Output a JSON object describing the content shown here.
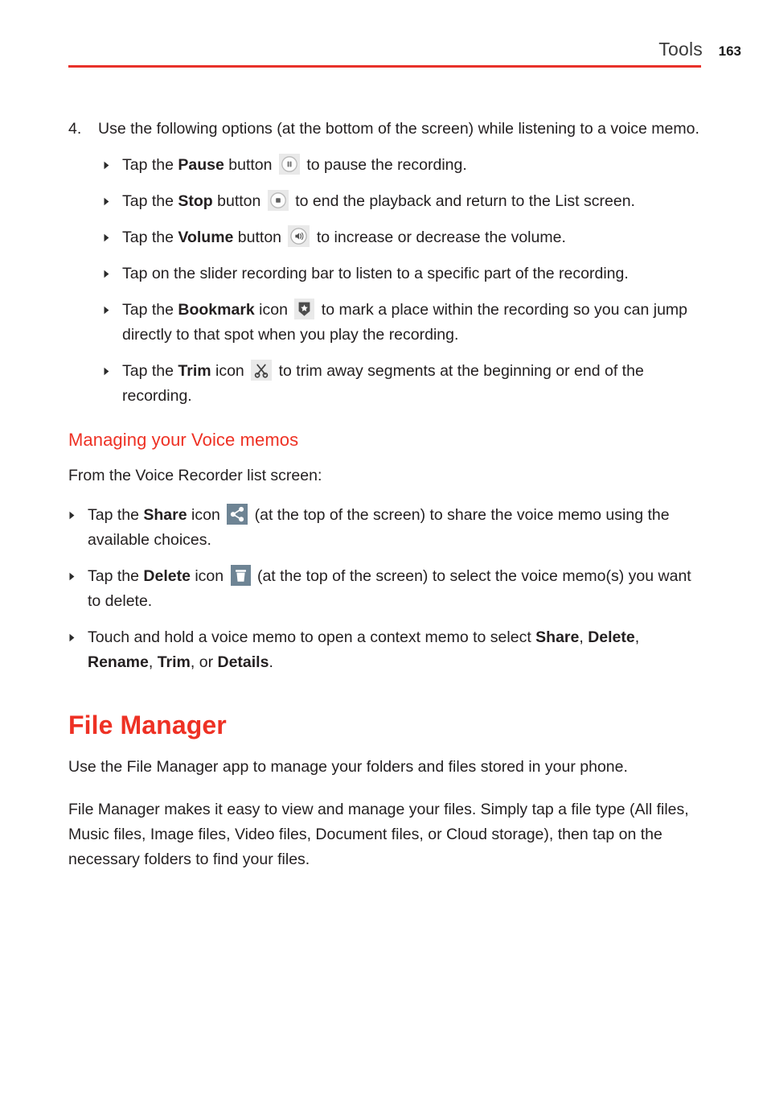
{
  "header": {
    "title": "Tools",
    "page_number": "163",
    "rule_color": "#e8312a"
  },
  "colors": {
    "accent_red": "#ee3124",
    "body_text": "#231f20",
    "icon_chip_gray": "#e9e9e9",
    "icon_chip_blue": "#6e8494",
    "icon_dark": "#4a4a4a"
  },
  "step": {
    "number": "4.",
    "text": "Use the following options (at the bottom of the screen) while listening to a voice memo."
  },
  "step_bullets": [
    {
      "id": "pause",
      "icon": "pause-button-icon",
      "parts": [
        {
          "t": "Tap the ",
          "b": false
        },
        {
          "t": "Pause",
          "b": true
        },
        {
          "t": " button ",
          "b": false
        }
      ],
      "after": " to pause the recording."
    },
    {
      "id": "stop",
      "icon": "stop-button-icon",
      "parts": [
        {
          "t": "Tap the ",
          "b": false
        },
        {
          "t": "Stop",
          "b": true
        },
        {
          "t": " button ",
          "b": false
        }
      ],
      "after": " to end the playback and return to the List screen."
    },
    {
      "id": "volume",
      "icon": "volume-button-icon",
      "parts": [
        {
          "t": "Tap the ",
          "b": false
        },
        {
          "t": "Volume",
          "b": true
        },
        {
          "t": " button ",
          "b": false
        }
      ],
      "after": " to increase or decrease the volume."
    },
    {
      "id": "slider",
      "icon": null,
      "parts": [
        {
          "t": "Tap on the slider recording bar to listen to a specific part of the recording.",
          "b": false
        }
      ],
      "after": ""
    },
    {
      "id": "bookmark",
      "icon": "bookmark-icon",
      "parts": [
        {
          "t": "Tap the ",
          "b": false
        },
        {
          "t": "Bookmark",
          "b": true
        },
        {
          "t": " icon ",
          "b": false
        }
      ],
      "after": " to mark a place within the recording so you can jump directly to that spot when you play the recording."
    },
    {
      "id": "trim",
      "icon": "trim-scissors-icon",
      "parts": [
        {
          "t": "Tap the ",
          "b": false
        },
        {
          "t": "Trim",
          "b": true
        },
        {
          "t": " icon ",
          "b": false
        }
      ],
      "after": " to trim away segments at the beginning or end of the recording."
    }
  ],
  "managing": {
    "heading": "Managing your Voice memos",
    "intro": "From the Voice Recorder list screen:",
    "bullets": [
      {
        "id": "share",
        "icon": "share-icon",
        "parts": [
          {
            "t": "Tap the ",
            "b": false
          },
          {
            "t": "Share",
            "b": true
          },
          {
            "t": " icon ",
            "b": false
          }
        ],
        "after": " (at the top of the screen) to share the voice memo using the available choices."
      },
      {
        "id": "delete",
        "icon": "delete-trash-icon",
        "parts": [
          {
            "t": "Tap the ",
            "b": false
          },
          {
            "t": "Delete",
            "b": true
          },
          {
            "t": " icon ",
            "b": false
          }
        ],
        "after": " (at the top of the screen) to select the voice memo(s) you want to delete."
      },
      {
        "id": "context",
        "icon": null,
        "parts": [
          {
            "t": "Touch and hold a voice memo to open a context memo to select ",
            "b": false
          },
          {
            "t": "Share",
            "b": true
          },
          {
            "t": ", ",
            "b": false
          },
          {
            "t": "Delete",
            "b": true
          },
          {
            "t": ", ",
            "b": false
          },
          {
            "t": "Rename",
            "b": true
          },
          {
            "t": ", ",
            "b": false
          },
          {
            "t": "Trim",
            "b": true
          },
          {
            "t": ", or ",
            "b": false
          },
          {
            "t": "Details",
            "b": true
          },
          {
            "t": ".",
            "b": false
          }
        ],
        "after": ""
      }
    ]
  },
  "file_manager": {
    "heading": "File Manager",
    "paragraph_1": "Use the File Manager app to manage your folders and files stored in your phone.",
    "paragraph_2": "File Manager makes it easy to view and manage your files. Simply tap a file type (All files, Music files, Image files, Video files, Document files, or Cloud storage), then tap on the necessary folders to find your files."
  }
}
